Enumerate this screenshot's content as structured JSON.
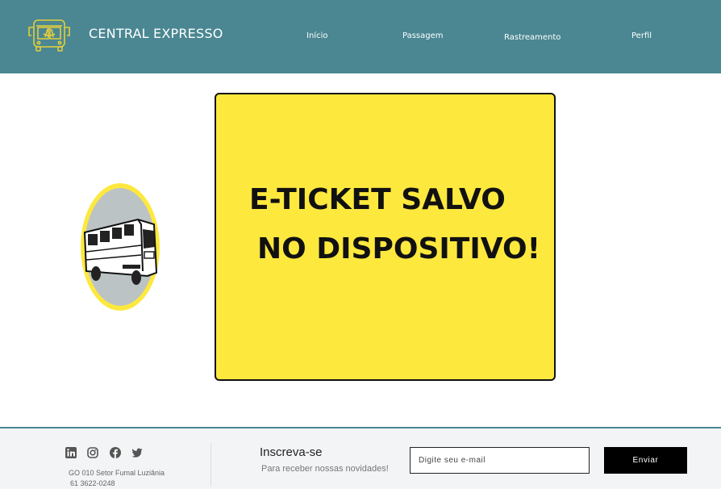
{
  "header": {
    "brand": "CENTRAL EXPRESSO",
    "nav": [
      {
        "label": "Início"
      },
      {
        "label": "Passagem"
      },
      {
        "label": "Rastreamento"
      },
      {
        "label": "Perfil"
      }
    ]
  },
  "ticket": {
    "line1": "E-TICKET SALVO",
    "line2": "NO DISPOSITIVO!"
  },
  "footer": {
    "social": [
      {
        "icon": "linkedin-icon"
      },
      {
        "icon": "instagram-icon"
      },
      {
        "icon": "facebook-icon"
      },
      {
        "icon": "twitter-icon"
      }
    ],
    "address": "GO 010 Setor Fumal Luziânia",
    "phone": "61 3622-0248",
    "subscribe_title": "Inscreva-se",
    "subscribe_text": "Para receber nossas novidades!",
    "email_placeholder": "Digite seu e-mail",
    "send_label": "Enviar"
  },
  "colors": {
    "header_bg": "#4a8792",
    "ticket_bg": "#fde83e",
    "logo_accent": "#e3cf3c"
  }
}
